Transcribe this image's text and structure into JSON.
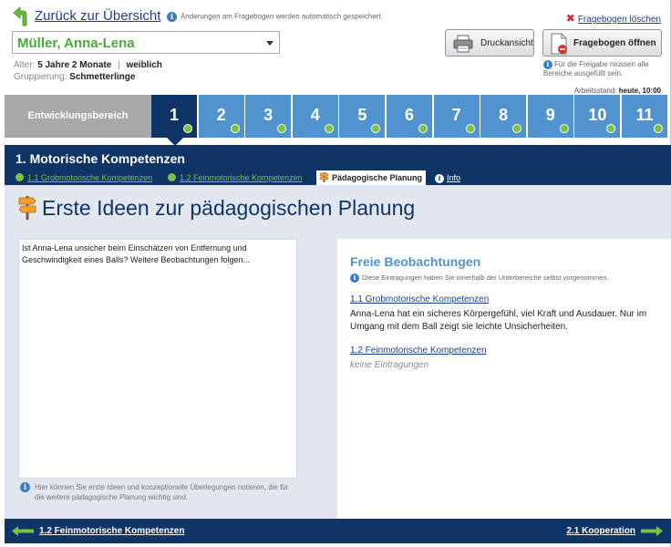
{
  "header": {
    "back_label": "Zurück zur Übersicht",
    "autosave_note": "Änderungen am Fragebogen werden automatisch gespeichert.",
    "delete_label": "Fragebogen löschen",
    "child_name": "Müller, Anna-Lena",
    "age_label": "Alter:",
    "age_value": "5 Jahre 2 Monate",
    "meta_separator": "|",
    "gender": "weiblich",
    "group_label": "Gruppierung:",
    "group_value": "Schmetterlinge",
    "print_label": "Druckansicht",
    "open_label": "Fragebogen öffnen",
    "release_note": "Für die Freigabe müssen alle Bereiche ausgefüllt sein.",
    "progress_label": "Arbeitsstand:",
    "progress_value": "heute, 10:00"
  },
  "steps": {
    "label": "Entwicklungsbereich",
    "items": [
      "1",
      "2",
      "3",
      "4",
      "5",
      "6",
      "7",
      "8",
      "9",
      "10",
      "11"
    ],
    "active_index": 0
  },
  "section": {
    "title": "1. Motorische Kompetenzen",
    "subtabs": [
      {
        "label": "1.1 Grobmotorische Kompetenzen",
        "state": "done"
      },
      {
        "label": "1.2 Feinmotorische Kompetenzen",
        "state": "done"
      },
      {
        "label": "Pädagogische Planung",
        "state": "active"
      },
      {
        "label": "Info",
        "state": "info"
      }
    ]
  },
  "main": {
    "heading": "Erste Ideen zur pädagogischen Planung",
    "notes_text": "Ist Anna-Lena unsicher beim Einschätzen von Entfernung und Geschwindigkeit eines Balls? Weitere Beobachtungen folgen...",
    "notes_hint": "Hier können Sie erste Ideen und konzeptionelle Überlegungen notieren, die für die weitere pädagogische Planung wichtig sind."
  },
  "observations": {
    "title": "Freie Beobachtungen",
    "subtitle": "Diese Eintragungen haben Sie innerhalb der Unterbereiche selbst vorgenommen.",
    "entries": [
      {
        "heading": "1.1 Grobmotorische Kompetenzen",
        "text": "Anna-Lena hat ein sicheres Körpergefühl, viel Kraft und Ausdauer. Nur im Umgang mit dem Ball zeigt sie leichte Unsicherheiten."
      },
      {
        "heading": "1.2 Feinmotorische Kompetenzen",
        "text": "keine Eintragungen"
      }
    ]
  },
  "footer": {
    "prev_label": "1.2 Feinmotorische Kompetenzen",
    "next_label": "2.1 Kooperation"
  },
  "colors": {
    "navy": "#0f3466",
    "step_blue": "#5193cf",
    "done_green": "#7cc242",
    "name_green": "#4aa93a",
    "panel_bg": "#e1e6ef"
  },
  "icons": {
    "back": "green-back-arrow-icon",
    "print": "printer-icon",
    "open": "document-icon",
    "delete": "red-x-icon",
    "planning": "signpost-icon",
    "info": "info-icon"
  }
}
